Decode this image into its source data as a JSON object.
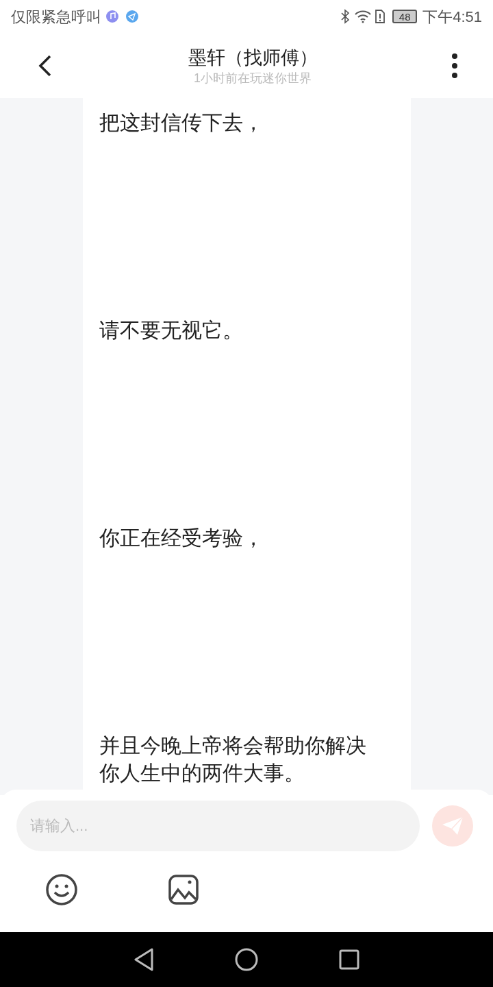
{
  "status_bar": {
    "carrier": "仅限紧急呼叫",
    "battery": "48",
    "time": "下午4:51"
  },
  "header": {
    "title": "墨轩（找师傅）",
    "subtitle": "1小时前在玩迷你世界"
  },
  "messages": [
    "把这封信传下去，",
    "请不要无视它。",
    "你正在经受考验，",
    "并且今晚上帝将会帮助你解决你人生中的两件大事。"
  ],
  "composer": {
    "placeholder": "请输入..."
  }
}
